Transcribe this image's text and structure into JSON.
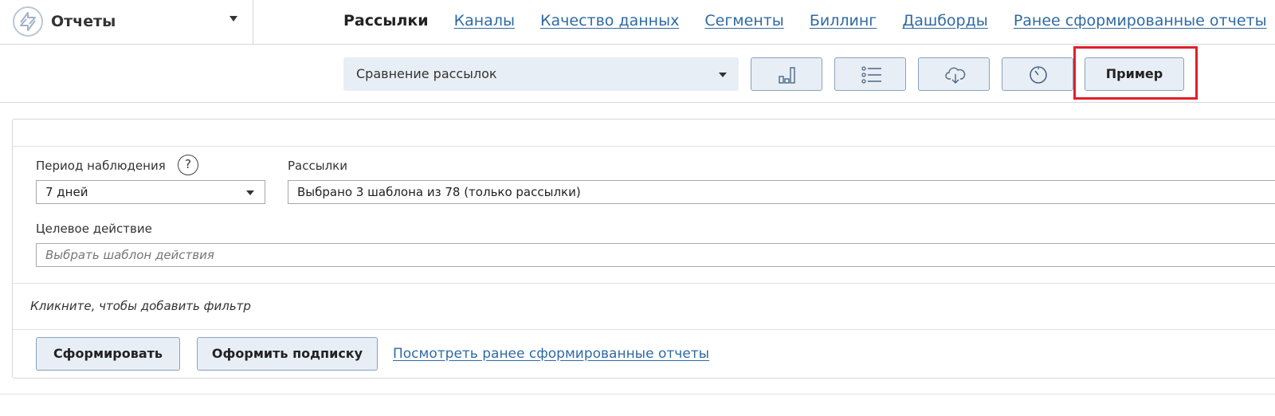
{
  "app": {
    "title": "Отчеты",
    "logo_icon": "refresh-arrows-icon"
  },
  "nav": {
    "items": [
      {
        "label": "Рассылки",
        "active": true
      },
      {
        "label": "Каналы",
        "active": false
      },
      {
        "label": "Качество данных",
        "active": false
      },
      {
        "label": "Сегменты",
        "active": false
      },
      {
        "label": "Биллинг",
        "active": false
      },
      {
        "label": "Дашборды",
        "active": false
      },
      {
        "label": "Ранее сформированные отчеты",
        "active": false
      }
    ]
  },
  "toolbar": {
    "report_type": "Сравнение рассылок",
    "icons": [
      "bar-chart-icon",
      "list-icon",
      "cloud-download-icon",
      "clock-icon"
    ],
    "example_label": "Пример",
    "highlight_color": "#e0202a"
  },
  "form": {
    "period": {
      "label": "Период наблюдения",
      "help": "?",
      "value": "7 дней"
    },
    "mailings": {
      "label": "Рассылки",
      "value": "Выбрано 3 шаблона из 78 (только рассылки)"
    },
    "target_action": {
      "label": "Целевое действие",
      "placeholder": "Выбрать шаблон действия"
    },
    "add_filter": "Кликните, чтобы добавить фильтр",
    "generate_label": "Сформировать",
    "subscribe_label": "Оформить подписку",
    "previous_reports_link": "Посмотреть ранее сформированные отчеты"
  },
  "colors": {
    "link": "#2f6aa3",
    "button_bg": "#e8eef5",
    "button_border": "#8aa3bd"
  }
}
